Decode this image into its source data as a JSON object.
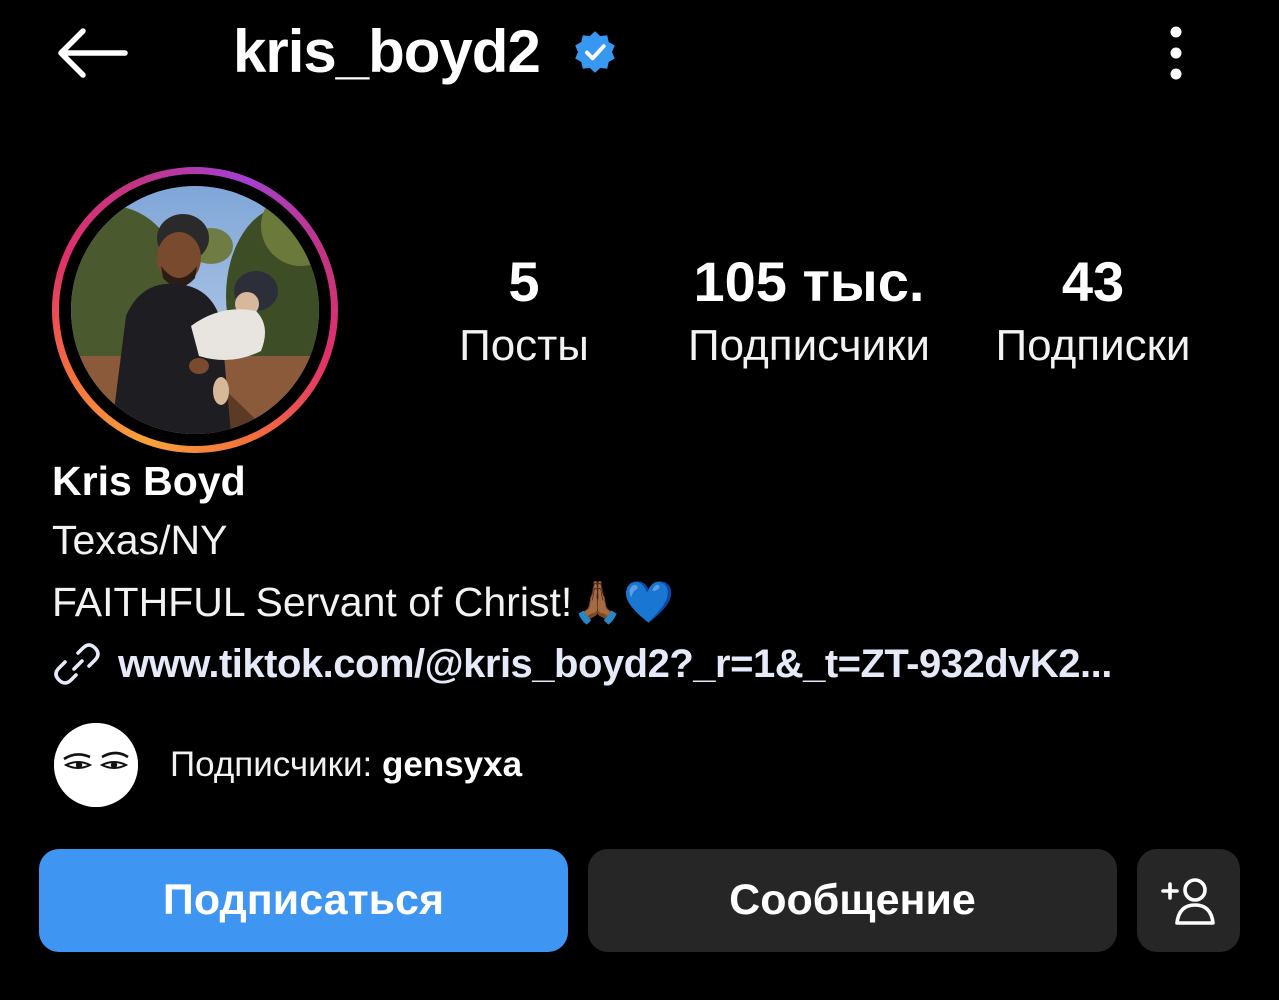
{
  "header": {
    "back_icon": "arrow-left-icon",
    "username": "kris_boyd2",
    "verified_icon": "verified-badge-icon",
    "verified_color": "#3897f0",
    "more_icon": "more-vertical-icon"
  },
  "stats": [
    {
      "value": "5",
      "label": "Посты"
    },
    {
      "value": "105 тыс.",
      "label": "Подписчики"
    },
    {
      "value": "43",
      "label": "Подписки"
    }
  ],
  "bio": {
    "name": "Kris Boyd",
    "location": "Texas/NY",
    "description": "FAITHFUL Servant of Christ!🙏🏾💙",
    "link_icon": "link-icon",
    "link": "www.tiktok.com/@kris_boyd2?_r=1&_t=ZT-932dvK2..."
  },
  "followed_by": {
    "prefix": "Подписчики: ",
    "username": "gensyxa"
  },
  "actions": {
    "follow_label": "Подписаться",
    "message_label": "Сообщение",
    "add_person_icon": "add-person-icon",
    "follow_color": "#3f95f2",
    "secondary_color": "#262626"
  }
}
